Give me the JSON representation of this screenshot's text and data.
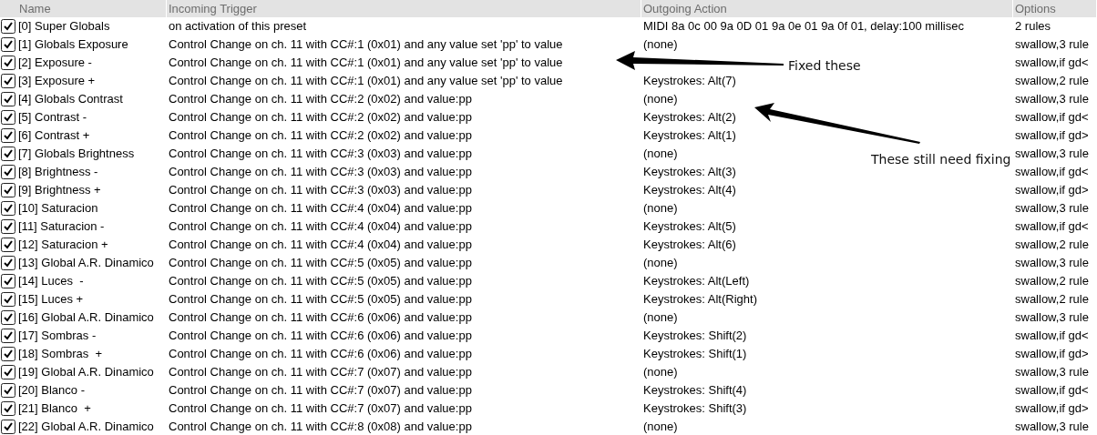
{
  "columns": [
    "Name",
    "Incoming Trigger",
    "Outgoing Action",
    "Options"
  ],
  "rows": [
    {
      "checked": true,
      "name": "[0] Super Globals",
      "trigger": "on activation of this preset",
      "action": "MIDI 8a 0c 00 9a 0D 01 9a 0e 01 9a 0f 01, delay:100 millisec",
      "options": "2 rules"
    },
    {
      "checked": true,
      "name": "[1] Globals Exposure",
      "trigger": "Control Change on ch. 11 with CC#:1 (0x01) and any value set 'pp' to value",
      "action": "(none)",
      "options": "swallow,3 rule"
    },
    {
      "checked": true,
      "name": "[2] Exposure -",
      "trigger": "Control Change on ch. 11 with CC#:1 (0x01) and any value set 'pp' to value",
      "options": "swallow,if gd<"
    },
    {
      "checked": true,
      "name": "[3] Exposure +",
      "trigger": "Control Change on ch. 11 with CC#:1 (0x01) and any value set 'pp' to value",
      "action": "Keystrokes: Alt(7)",
      "options": "swallow,2 rule"
    },
    {
      "checked": true,
      "name": "[4] Globals Contrast",
      "trigger": "Control Change on ch. 11 with CC#:2 (0x02) and value:pp",
      "action": "(none)",
      "options": "swallow,3 rule"
    },
    {
      "checked": true,
      "name": "[5] Contrast -",
      "trigger": "Control Change on ch. 11 with CC#:2 (0x02) and value:pp",
      "action": "Keystrokes: Alt(2)",
      "options": "swallow,if gd<"
    },
    {
      "checked": true,
      "name": "[6] Contrast +",
      "trigger": "Control Change on ch. 11 with CC#:2 (0x02) and value:pp",
      "action": "Keystrokes: Alt(1)",
      "options": "swallow,if gd>"
    },
    {
      "checked": true,
      "name": "[7] Globals Brightness",
      "trigger": "Control Change on ch. 11 with CC#:3 (0x03) and value:pp",
      "action": "(none)",
      "options": "swallow,3 rule"
    },
    {
      "checked": true,
      "name": "[8] Brightness -",
      "trigger": "Control Change on ch. 11 with CC#:3 (0x03) and value:pp",
      "action": "Keystrokes: Alt(3)",
      "options": "swallow,if gd<"
    },
    {
      "checked": true,
      "name": "[9] Brightness +",
      "trigger": "Control Change on ch. 11 with CC#:3 (0x03) and value:pp",
      "action": "Keystrokes: Alt(4)",
      "options": "swallow,if gd>"
    },
    {
      "checked": true,
      "name": "[10] Saturacion",
      "trigger": "Control Change on ch. 11 with CC#:4 (0x04) and value:pp",
      "action": "(none)",
      "options": "swallow,3 rule"
    },
    {
      "checked": true,
      "name": "[11] Saturacion -",
      "trigger": "Control Change on ch. 11 with CC#:4 (0x04) and value:pp",
      "action": "Keystrokes: Alt(5)",
      "options": "swallow,if gd<"
    },
    {
      "checked": true,
      "name": "[12] Saturacion +",
      "trigger": "Control Change on ch. 11 with CC#:4 (0x04) and value:pp",
      "action": "Keystrokes: Alt(6)",
      "options": "swallow,2 rule"
    },
    {
      "checked": true,
      "name": "[13] Global A.R. Dinamico",
      "trigger": "Control Change on ch. 11 with CC#:5 (0x05) and value:pp",
      "action": "(none)",
      "options": "swallow,3 rule"
    },
    {
      "checked": true,
      "name": "[14] Luces  -",
      "trigger": "Control Change on ch. 11 with CC#:5 (0x05) and value:pp",
      "action": "Keystrokes: Alt(Left)",
      "options": "swallow,2 rule"
    },
    {
      "checked": true,
      "name": "[15] Luces +",
      "trigger": "Control Change on ch. 11 with CC#:5 (0x05) and value:pp",
      "action": "Keystrokes: Alt(Right)",
      "options": "swallow,2 rule"
    },
    {
      "checked": true,
      "name": "[16] Global A.R. Dinamico",
      "trigger": "Control Change on ch. 11 with CC#:6 (0x06) and value:pp",
      "action": "(none)",
      "options": "swallow,3 rule"
    },
    {
      "checked": true,
      "name": "[17] Sombras -",
      "trigger": "Control Change on ch. 11 with CC#:6 (0x06) and value:pp",
      "action": "Keystrokes: Shift(2)",
      "options": "swallow,if gd<"
    },
    {
      "checked": true,
      "name": "[18] Sombras  +",
      "trigger": "Control Change on ch. 11 with CC#:6 (0x06) and value:pp",
      "action": "Keystrokes: Shift(1)",
      "options": "swallow,if gd>"
    },
    {
      "checked": true,
      "name": "[19] Global A.R. Dinamico",
      "trigger": "Control Change on ch. 11 with CC#:7 (0x07) and value:pp",
      "action": "(none)",
      "options": "swallow,3 rule"
    },
    {
      "checked": true,
      "name": "[20] Blanco -",
      "trigger": "Control Change on ch. 11 with CC#:7 (0x07) and value:pp",
      "action": "Keystrokes: Shift(4)",
      "options": "swallow,if gd<"
    },
    {
      "checked": true,
      "name": "[21] Blanco  +",
      "trigger": "Control Change on ch. 11 with CC#:7 (0x07) and value:pp",
      "action": "Keystrokes: Shift(3)",
      "options": "swallow,if gd>"
    },
    {
      "checked": true,
      "name": "[22] Global A.R. Dinamico",
      "trigger": "Control Change on ch. 11 with CC#:8 (0x08) and value:pp",
      "action": "(none)",
      "options": "swallow,3 rule"
    }
  ],
  "annotations": [
    "Fixed these",
    "These still need fixing"
  ]
}
